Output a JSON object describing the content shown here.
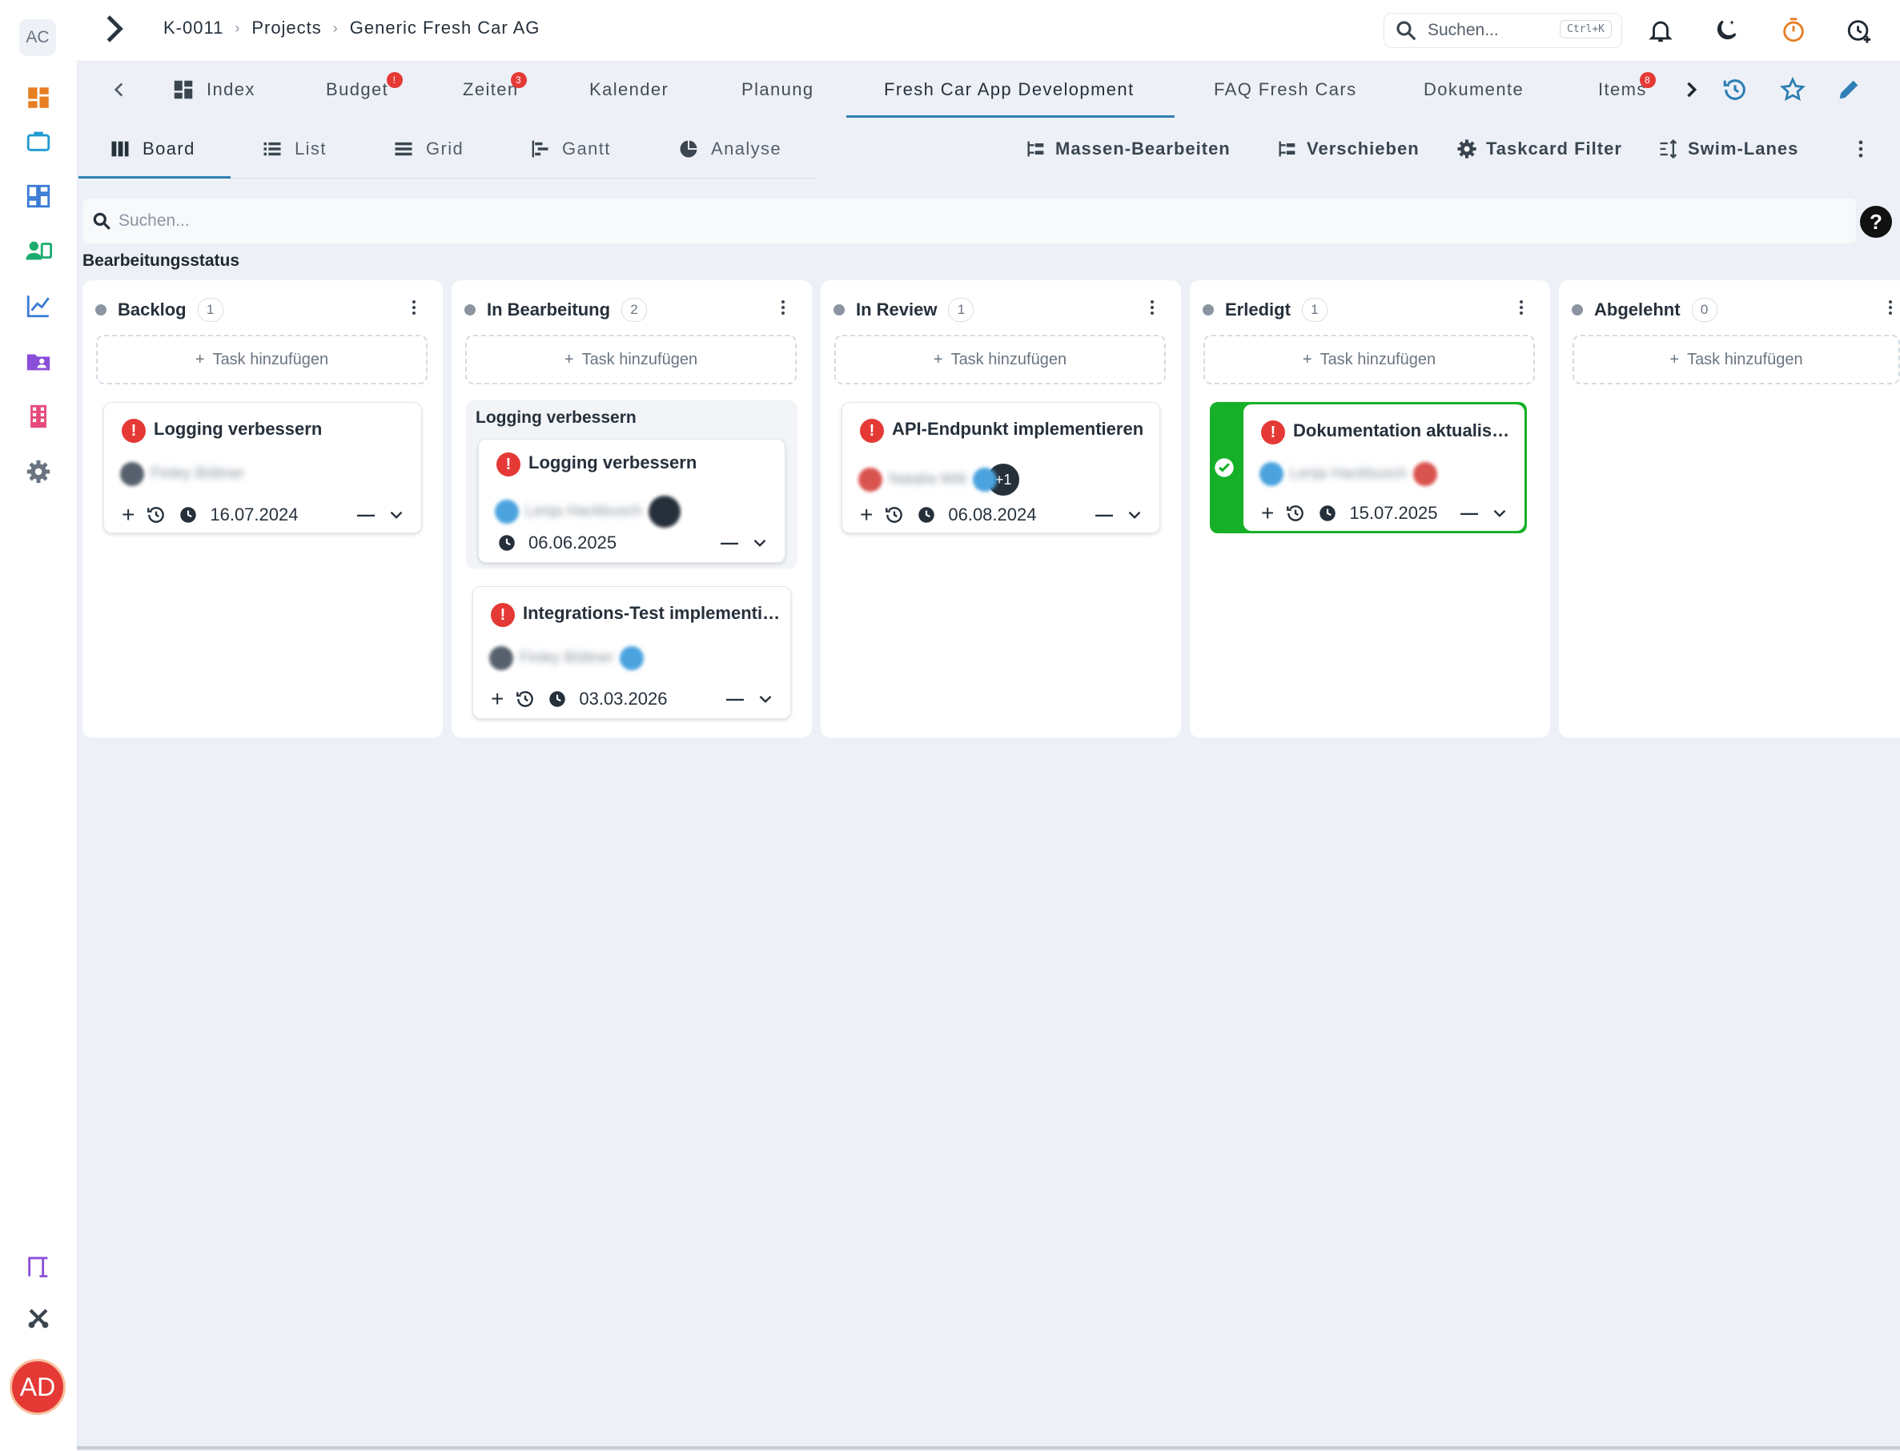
{
  "sidebar": {
    "logo": "AC",
    "user_initials": "AD",
    "items": [
      {
        "name": "dashboard-icon",
        "color": "#e67e22"
      },
      {
        "name": "briefcase-icon",
        "color": "#1f9bd1"
      },
      {
        "name": "layout-icon",
        "color": "#3b7bd6"
      },
      {
        "name": "contacts-icon",
        "color": "#1aab6e"
      },
      {
        "name": "chart-line-icon",
        "color": "#3b7bd6"
      },
      {
        "name": "folder-user-icon",
        "color": "#8a4fd8"
      },
      {
        "name": "building-icon",
        "color": "#e64a7b"
      },
      {
        "name": "gear-icon",
        "color": "#6a7480"
      },
      {
        "name": "tree-structure-icon",
        "color": "#8a4fd8"
      },
      {
        "name": "percent-tools-icon",
        "color": "#3a4550"
      }
    ]
  },
  "topbar": {
    "breadcrumb": [
      "K-0011",
      "Projects",
      "Generic Fresh Car AG"
    ],
    "search_placeholder": "Suchen...",
    "search_shortcut": "Ctrl+K"
  },
  "tabs": {
    "items": [
      {
        "label": "Index",
        "badge": ""
      },
      {
        "label": "Budget",
        "badge": "!"
      },
      {
        "label": "Zeiten",
        "badge": "3"
      },
      {
        "label": "Kalender",
        "badge": ""
      },
      {
        "label": "Planung",
        "badge": ""
      },
      {
        "label": "Fresh Car App Development",
        "badge": ""
      },
      {
        "label": "FAQ Fresh Cars",
        "badge": ""
      },
      {
        "label": "Dokumente",
        "badge": ""
      },
      {
        "label": "Items",
        "badge": "8"
      }
    ],
    "active": "Fresh Car App Development"
  },
  "views": {
    "items": [
      "Board",
      "List",
      "Grid",
      "Gantt",
      "Analyse"
    ],
    "active": "Board",
    "actions": [
      "Massen-Bearbeiten",
      "Verschieben",
      "Taskcard Filter",
      "Swim-Lanes"
    ]
  },
  "board": {
    "search_placeholder": "Suchen...",
    "help": "?",
    "group_title": "Bearbeitungsstatus",
    "add_task_label": "Task hinzufügen",
    "columns": [
      {
        "title": "Backlog",
        "count": "1",
        "cards": [
          {
            "title": "Logging verbessern",
            "assignee": "Finley Böttner",
            "date": "16.07.2024"
          }
        ]
      },
      {
        "title": "In Bearbeitung",
        "count": "2",
        "subgroup_label": "Logging verbessern",
        "cards": [
          {
            "title": "Logging verbessern",
            "assignee": "Lenja Hackbusch",
            "date": "06.06.2025"
          },
          {
            "title": "Integrations-Test implementi…",
            "assignee": "Finley Böttner",
            "date": "03.03.2026"
          }
        ]
      },
      {
        "title": "In Review",
        "count": "1",
        "cards": [
          {
            "title": "API-Endpunkt implementieren",
            "assignee": "Natalia Witt",
            "extra": "+1",
            "date": "06.08.2024"
          }
        ]
      },
      {
        "title": "Erledigt",
        "count": "1",
        "cards": [
          {
            "title": "Dokumentation aktualisi…",
            "assignee": "Lenja Hackbusch",
            "date": "15.07.2025"
          }
        ]
      },
      {
        "title": "Abgelehnt",
        "count": "0",
        "cards": []
      }
    ]
  },
  "colors": {
    "accent": "#2f7fb5",
    "priority": "#e53935",
    "done": "#16b028",
    "background": "#edf1f7"
  }
}
